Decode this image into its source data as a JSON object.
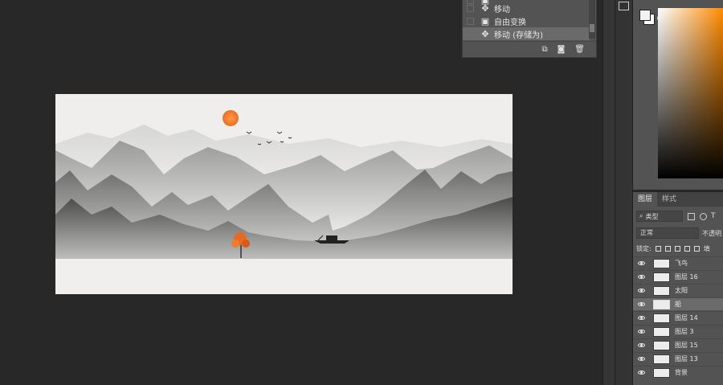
{
  "history": {
    "items": [
      {
        "label": "移动",
        "icon": "move-icon",
        "selected": false
      },
      {
        "label": "自由变换",
        "icon": "transform-icon",
        "selected": false
      },
      {
        "label": "移动 (存储为)",
        "icon": "move-icon",
        "selected": true
      }
    ]
  },
  "layers_panel": {
    "tab_layers": "图层",
    "tab_styles": "样式",
    "filter_kind": "类型",
    "blend_mode": "正常",
    "opacity_label": "不透明",
    "lock_label": "锁定:",
    "fill_label": "填",
    "layers": [
      {
        "name": "飞鸟",
        "selected": false
      },
      {
        "name": "图层 16",
        "selected": false
      },
      {
        "name": "太阳",
        "selected": false
      },
      {
        "name": "船",
        "selected": true
      },
      {
        "name": "图层 14",
        "selected": false
      },
      {
        "name": "图层 3",
        "selected": false
      },
      {
        "name": "图层 15",
        "selected": false
      },
      {
        "name": "图层 13",
        "selected": false
      },
      {
        "name": "背景",
        "selected": false
      }
    ]
  },
  "colors": {
    "accent_sun": "#f07a2a",
    "workspace": "#282828",
    "panel": "#535353"
  }
}
